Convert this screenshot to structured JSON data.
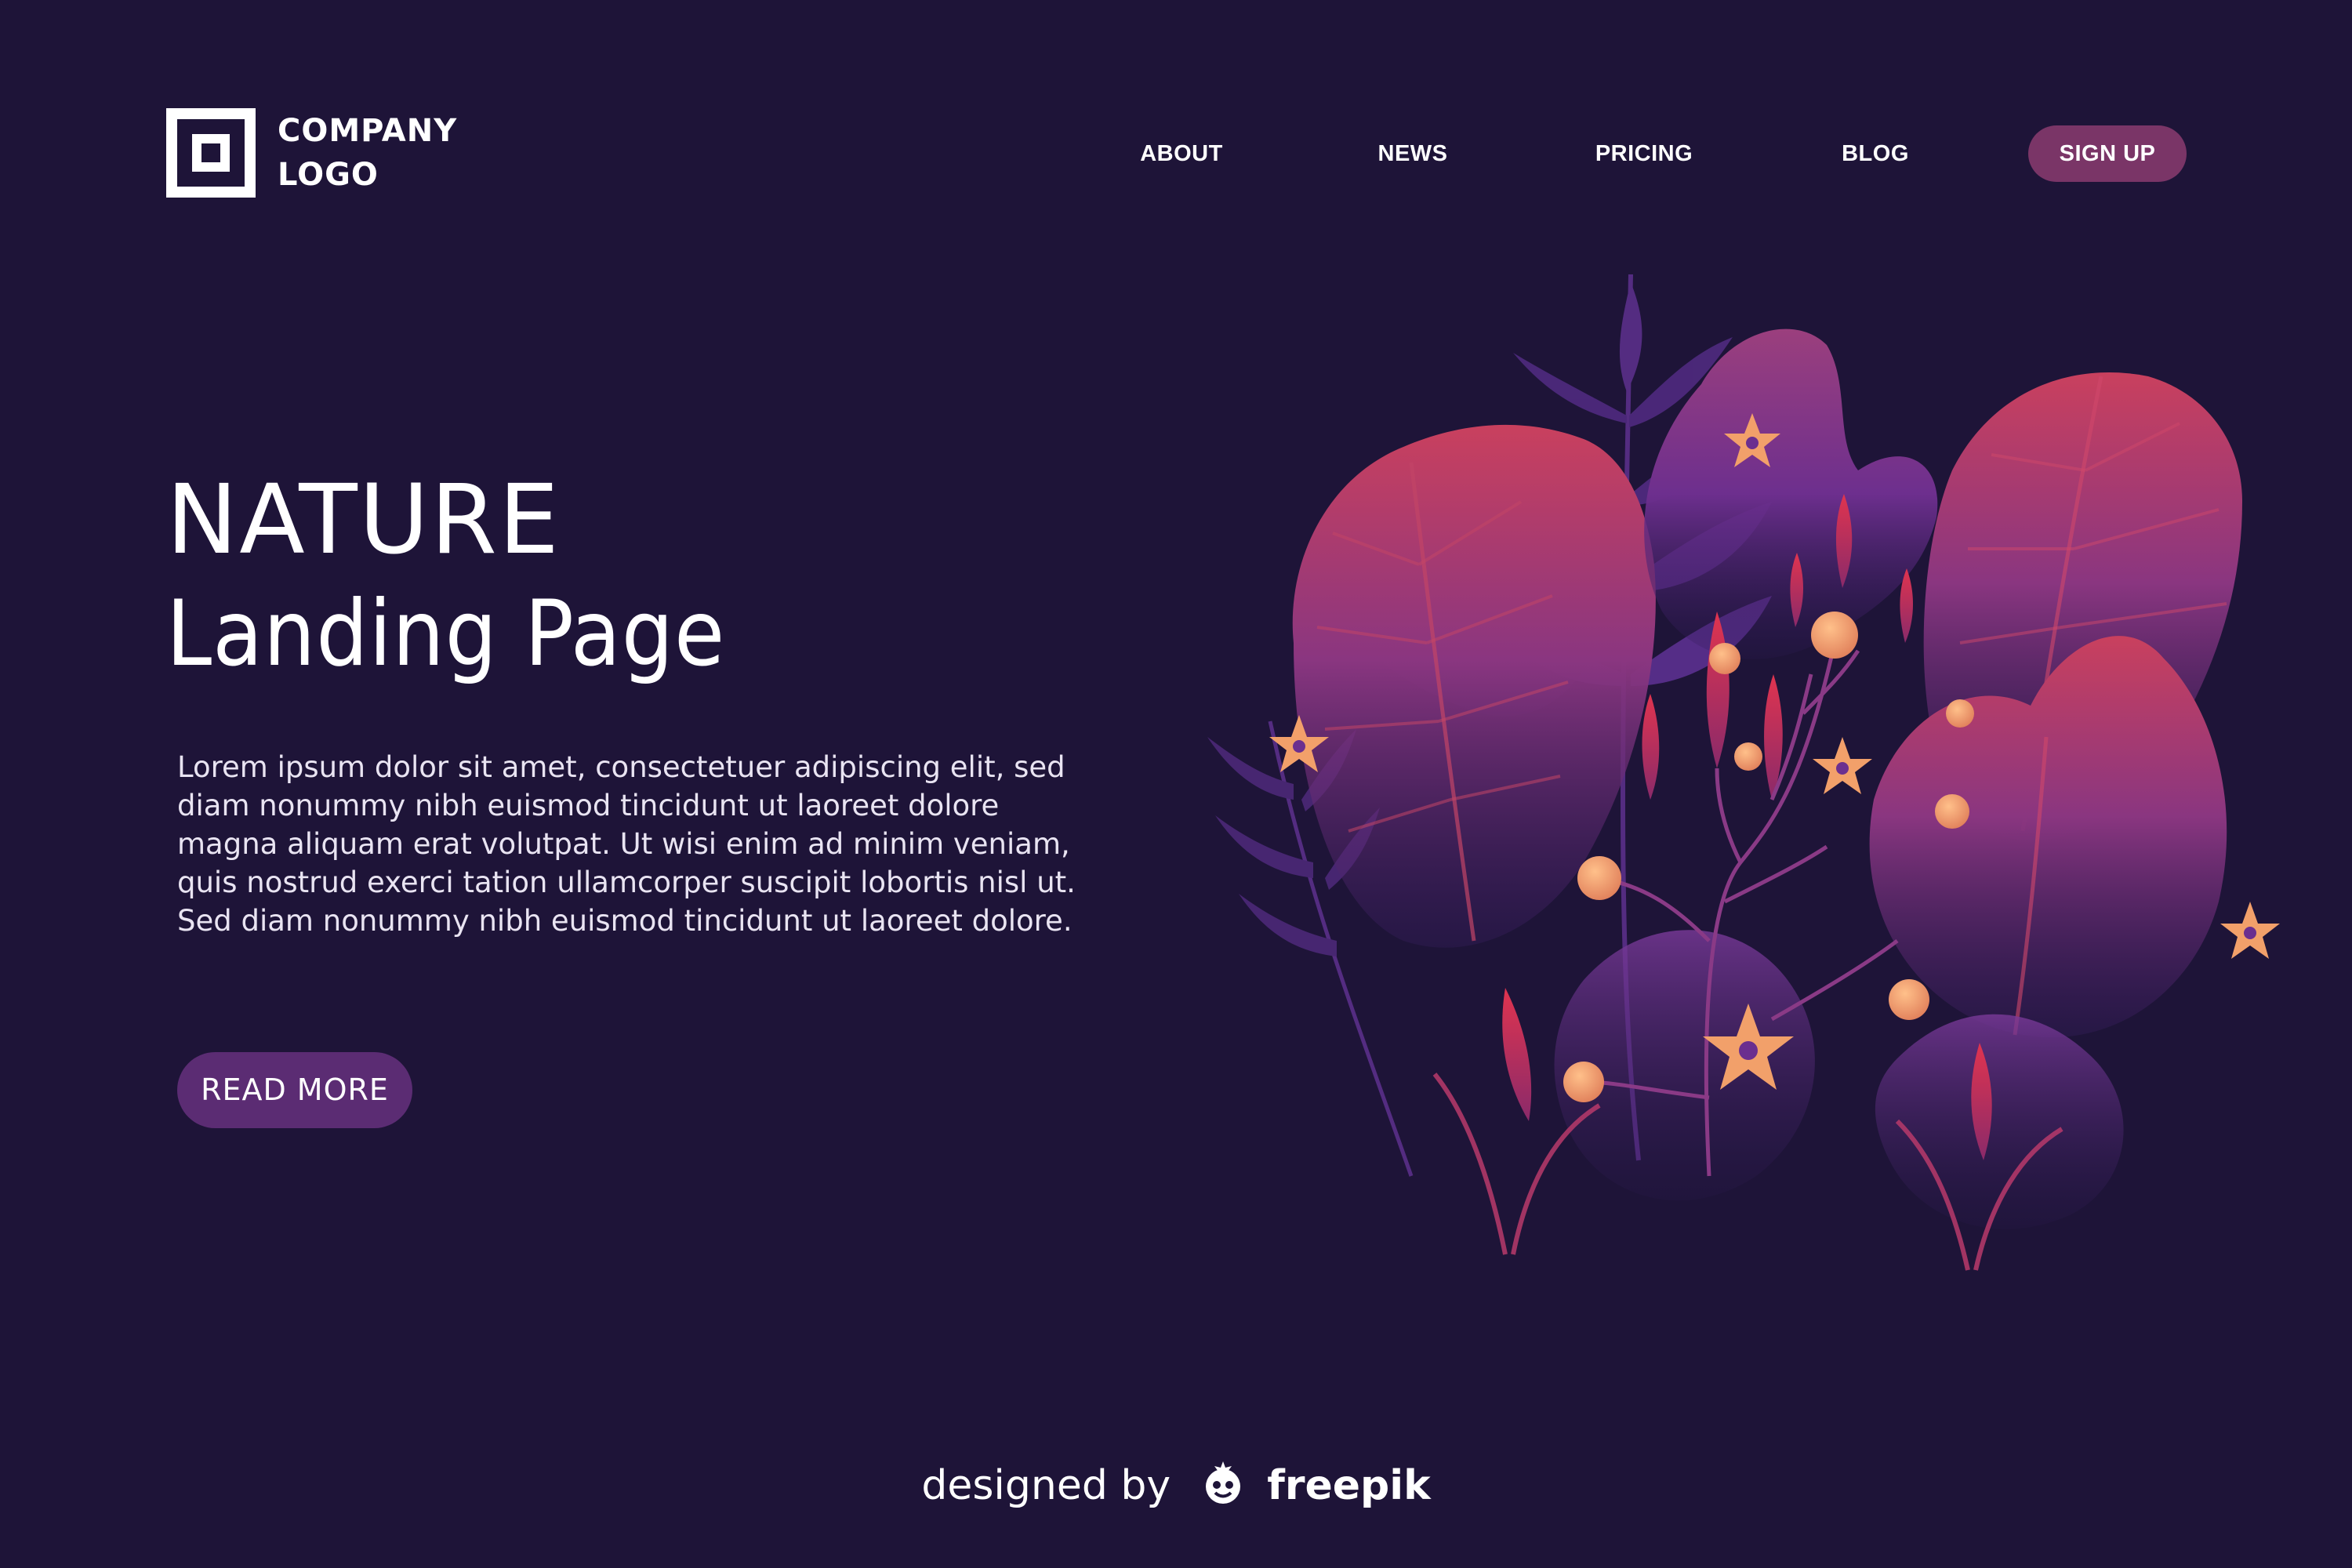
{
  "header": {
    "logo_line1": "COMPANY",
    "logo_line2": "LOGO",
    "nav": [
      {
        "label": "ABOUT"
      },
      {
        "label": "NEWS"
      },
      {
        "label": "PRICING"
      },
      {
        "label": "BLOG"
      }
    ],
    "signup_label": "SIGN UP"
  },
  "hero": {
    "title": "NATURE",
    "subtitle": "Landing Page",
    "body": "Lorem ipsum dolor sit amet, consectetuer adipiscing elit, sed diam nonummy nibh euismod tincidunt ut laoreet dolore magna aliquam erat volutpat. Ut wisi enim ad minim veniam, quis nostrud exerci tation ullamcorper suscipit lobortis nisl ut. Sed diam nonummy nibh euismod tincidunt ut laoreet dolore.",
    "cta_label": "READ MORE"
  },
  "footer": {
    "credit_prefix": "designed by",
    "credit_brand": "freepik"
  },
  "colors": {
    "background": "#1e1438",
    "signup_button": "#7a3567",
    "read_more_button": "#5b2c73",
    "leaf_purple": "#6b2f8f",
    "leaf_pink": "#b83a6b",
    "flower_orange": "#f2a06a"
  },
  "icons": {
    "logo": "square-logo-icon",
    "credit": "freepik-logo-icon"
  }
}
